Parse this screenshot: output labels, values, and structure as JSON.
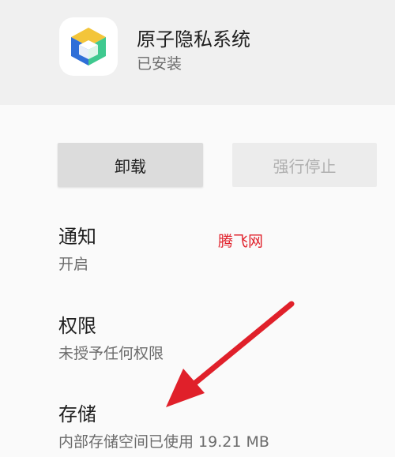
{
  "app": {
    "name": "原子隐私系统",
    "status": "已安装",
    "icon": "cube-app-icon"
  },
  "actions": {
    "uninstall_label": "卸载",
    "force_stop_label": "强行停止"
  },
  "settings": [
    {
      "title": "通知",
      "subtitle": "开启"
    },
    {
      "title": "权限",
      "subtitle": "未授予任何权限"
    },
    {
      "title": "存储",
      "subtitle": "内部存储空间已使用 19.21 MB"
    }
  ],
  "watermark": "腾飞网",
  "colors": {
    "header_bg": "#f0f0f0",
    "page_bg": "#fafafa",
    "uninstall_bg": "#dcdcdc",
    "force_stop_bg": "#ececec",
    "annotation_red": "#e0202a"
  }
}
